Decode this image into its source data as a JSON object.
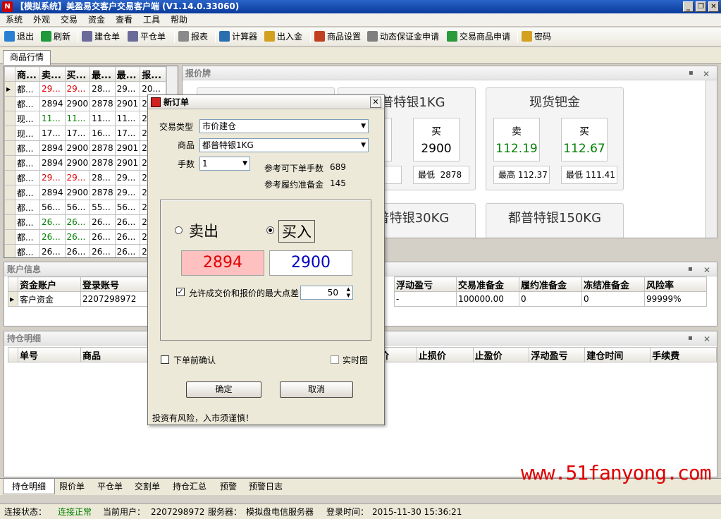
{
  "window": {
    "title": "【模拟系统】美盈易交客户交易客户端 (V1.14.0.33060)",
    "app_icon": "N",
    "minimize": "_",
    "restore": "❐",
    "close": "✕"
  },
  "menu": [
    "系统",
    "外观",
    "交易",
    "资金",
    "查看",
    "工具",
    "帮助"
  ],
  "toolbar": [
    {
      "label": "退出",
      "icon": "exit-icon",
      "color": "#2a7fd4"
    },
    {
      "label": "刷新",
      "icon": "refresh-icon",
      "color": "#1e9a3a"
    },
    {
      "label": "建仓单",
      "icon": "open-order-icon",
      "color": "#6b6b9a"
    },
    {
      "label": "平仓单",
      "icon": "close-order-icon",
      "color": "#6b6b9a"
    },
    {
      "label": "报表",
      "icon": "report-icon",
      "color": "#8a8a8a"
    },
    {
      "label": "计算器",
      "icon": "calculator-icon",
      "color": "#2a6fb0"
    },
    {
      "label": "出入金",
      "icon": "money-icon",
      "color": "#d4a020"
    },
    {
      "label": "商品设置",
      "icon": "tools-icon",
      "color": "#c04020"
    },
    {
      "label": "动态保证金申请",
      "icon": "margin-icon",
      "color": "#808080"
    },
    {
      "label": "交易商品申请",
      "icon": "apply-icon",
      "color": "#2a9a3a"
    },
    {
      "label": "密码",
      "icon": "key-icon",
      "color": "#d4a020"
    }
  ],
  "tabs": {
    "market": "商品行情"
  },
  "quote_grid": {
    "headers": [
      "商...",
      "卖...",
      "买...",
      "最...",
      "最...",
      "报..."
    ],
    "rows": [
      {
        "c": [
          "都...",
          "29...",
          "29...",
          "28...",
          "29...",
          "20..."
        ],
        "color": "red",
        "selected": true
      },
      {
        "c": [
          "都...",
          "2894",
          "2900",
          "2878",
          "2901",
          "20..."
        ],
        "color": "",
        "selected": false
      },
      {
        "c": [
          "现...",
          "11...",
          "11...",
          "11...",
          "11...",
          "20..."
        ],
        "color": "green",
        "selected": false
      },
      {
        "c": [
          "现...",
          "17...",
          "17...",
          "16...",
          "17...",
          "20..."
        ],
        "color": "",
        "selected": false
      },
      {
        "c": [
          "都...",
          "2894",
          "2900",
          "2878",
          "2901",
          "20..."
        ],
        "color": "",
        "selected": false
      },
      {
        "c": [
          "都...",
          "2894",
          "2900",
          "2878",
          "2901",
          "20..."
        ],
        "color": "",
        "selected": false
      },
      {
        "c": [
          "都...",
          "29...",
          "29...",
          "28...",
          "29...",
          "20..."
        ],
        "color": "red",
        "selected": false
      },
      {
        "c": [
          "都...",
          "2894",
          "2900",
          "2878",
          "29...",
          "20..."
        ],
        "color": "",
        "selected": false
      },
      {
        "c": [
          "都...",
          "56...",
          "56...",
          "55...",
          "56...",
          "20..."
        ],
        "color": "",
        "selected": false
      },
      {
        "c": [
          "都...",
          "26...",
          "26...",
          "26...",
          "26...",
          "20..."
        ],
        "color": "green",
        "selected": false
      },
      {
        "c": [
          "都...",
          "26...",
          "26...",
          "26...",
          "26...",
          "20..."
        ],
        "color": "green",
        "selected": false
      },
      {
        "c": [
          "都...",
          "26...",
          "26...",
          "26...",
          "26...",
          "20..."
        ],
        "color": "",
        "selected": false
      }
    ]
  },
  "board": {
    "title": "报价牌",
    "cards": [
      {
        "title": "都普特银1KG",
        "sell_label": "卖",
        "buy_label": "买",
        "buy": "2900",
        "low_label": "最低",
        "low": "2878"
      },
      {
        "title": "现货钯金",
        "sell_label": "卖",
        "buy_label": "买",
        "sell": "112.19",
        "buy": "112.67",
        "high_label": "最高",
        "high": "112.37",
        "low_label": "最低",
        "low": "111.41"
      },
      {
        "title": "都普特银30KG"
      },
      {
        "title": "都普特银150KG"
      }
    ],
    "partial_mini": "1",
    "partial_title": "银"
  },
  "account": {
    "title": "账户信息",
    "left_headers": [
      "资金账户",
      "登录账号"
    ],
    "left_row": [
      "客户资金",
      "2207298972"
    ],
    "right_headers": [
      "浮动盈亏",
      "交易准备金",
      "履约准备金",
      "冻结准备金",
      "风险率"
    ],
    "right_row": [
      "-",
      "100000.00",
      "0",
      "0",
      "99999%"
    ]
  },
  "positions": {
    "title": "持仓明细",
    "left_headers": [
      "单号",
      "商品"
    ],
    "right_headers": [
      "价",
      "止损价",
      "止盈价",
      "浮动盈亏",
      "建仓时间",
      "手续费"
    ]
  },
  "bottom_tabs": [
    "持仓明细",
    "限价单",
    "平仓单",
    "交割单",
    "持仓汇总",
    "预警",
    "预警日志"
  ],
  "status": {
    "conn_label": "连接状态：",
    "conn_value": "连接正常",
    "user_label": "当前用户：",
    "user_value": "2207298972",
    "server_label": "服务器：",
    "server_value": "模拟盘电信服务器",
    "login_label": "登录时间：",
    "login_value": "2015-11-30  15:36:21"
  },
  "watermark": "www.51fanyong.com",
  "dialog": {
    "title": "新订单",
    "trade_type_label": "交易类型",
    "trade_type_value": "市价建仓",
    "product_label": "商品",
    "product_value": "都普特银1KG",
    "lots_label": "手数",
    "lots_value": "1",
    "ref_lots_label": "参考可下单手数",
    "ref_lots_value": "689",
    "ref_margin_label": "参考履约准备金",
    "ref_margin_value": "145",
    "sell_label": "卖出",
    "buy_label": "买入",
    "sell_price": "2894",
    "buy_price": "2900",
    "max_diff_label": "允许成交价和报价的最大点差",
    "max_diff_value": "50",
    "confirm_before_label": "下单前确认",
    "realtime_chart_label": "实时图",
    "ok_label": "确定",
    "cancel_label": "取消",
    "risk_note": "投资有风险，入市须谨慎！",
    "sell_bg": "#ffc0c0",
    "sell_color": "#e00000",
    "buy_color": "#0000c0"
  }
}
